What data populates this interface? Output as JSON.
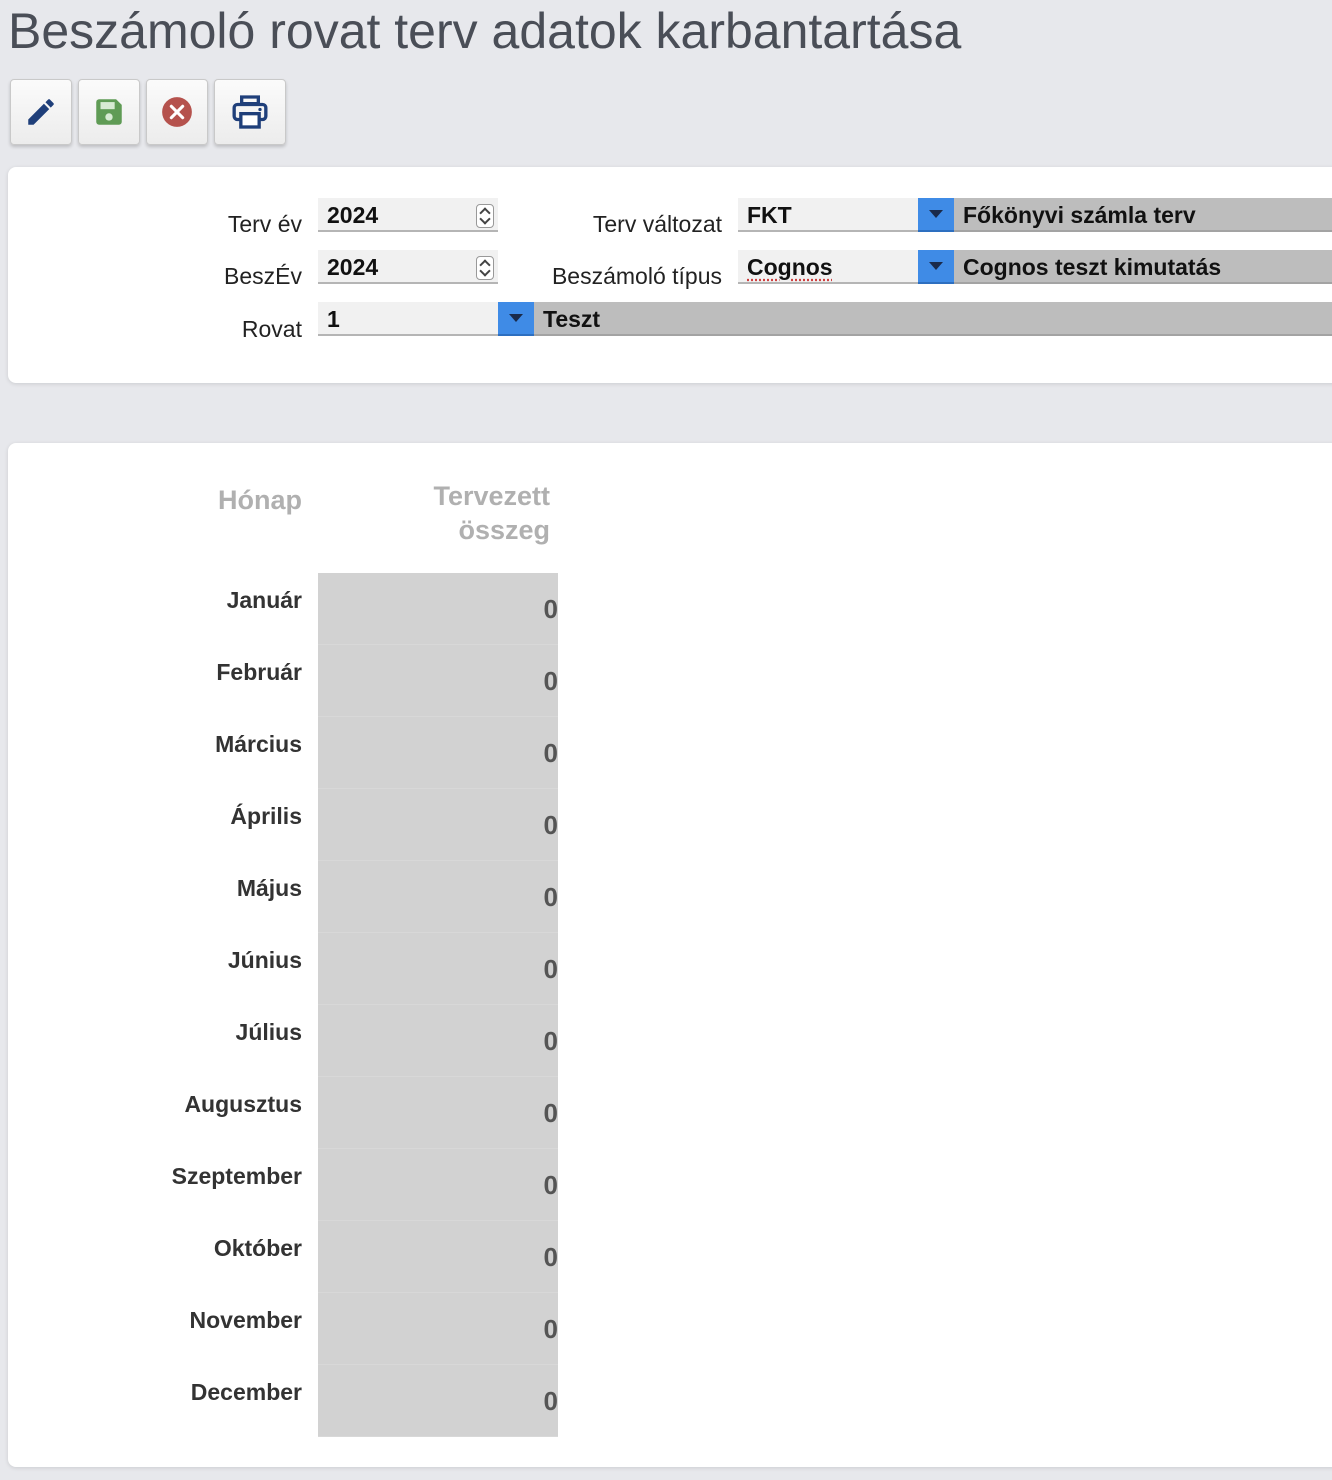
{
  "page": {
    "title": "Beszámoló rovat terv adatok karbantartása"
  },
  "toolbar": {
    "edit": "pencil-icon",
    "save": "save-icon",
    "cancel": "cancel-icon",
    "print": "printer-icon"
  },
  "filters": {
    "terv_ev": {
      "label": "Terv év",
      "value": "2024"
    },
    "besz_ev": {
      "label": "BeszÉv",
      "value": "2024"
    },
    "rovat": {
      "label": "Rovat",
      "code": "1",
      "description": "Teszt"
    },
    "terv_valtozat": {
      "label": "Terv változat",
      "code": "FKT",
      "description": "Főkönyvi számla terv"
    },
    "beszamolo_tipus": {
      "label": "Beszámoló típus",
      "code": "Cognos",
      "description": "Cognos teszt kimutatás"
    }
  },
  "table": {
    "headers": {
      "month": "Hónap",
      "amount_line1": "Tervezett",
      "amount_line2": "összeg"
    },
    "rows": [
      {
        "month": "Január",
        "amount": "0"
      },
      {
        "month": "Február",
        "amount": "0"
      },
      {
        "month": "Március",
        "amount": "0"
      },
      {
        "month": "Április",
        "amount": "0"
      },
      {
        "month": "Május",
        "amount": "0"
      },
      {
        "month": "Június",
        "amount": "0"
      },
      {
        "month": "Július",
        "amount": "0"
      },
      {
        "month": "Augusztus",
        "amount": "0"
      },
      {
        "month": "Szeptember",
        "amount": "0"
      },
      {
        "month": "Október",
        "amount": "0"
      },
      {
        "month": "November",
        "amount": "0"
      },
      {
        "month": "December",
        "amount": "0"
      }
    ]
  },
  "colors": {
    "accent": "#3f8be6",
    "edit_icon": "#1f3f7a",
    "save_icon": "#5f9b55",
    "cancel_icon": "#b5524d",
    "print_icon": "#1f3f7a"
  }
}
